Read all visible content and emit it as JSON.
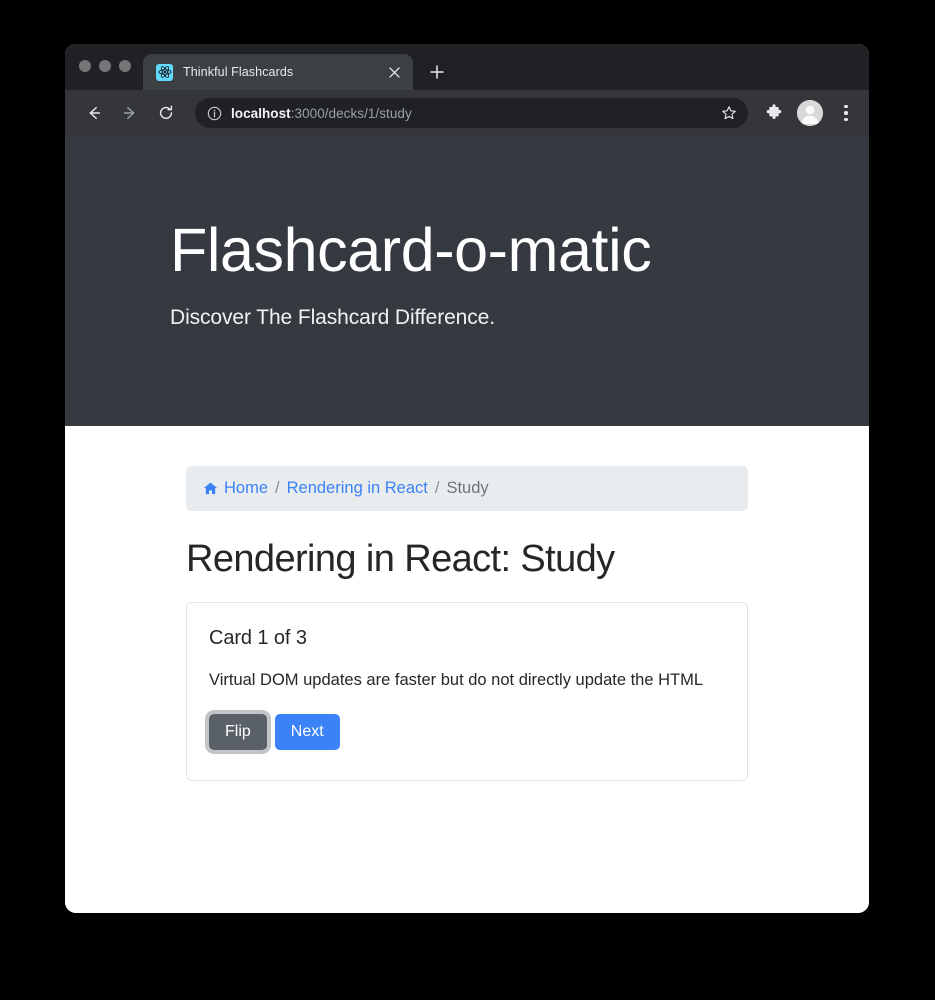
{
  "browser": {
    "traffic_lights": [
      "close",
      "minimize",
      "maximize"
    ],
    "tab": {
      "title": "Thinkful Flashcards",
      "favicon": "react-logo-icon",
      "close_label": "✕"
    },
    "new_tab_label": "+",
    "nav": {
      "back": "←",
      "forward": "→",
      "reload": "⟳"
    },
    "omnibox": {
      "site_info_icon": "info-circle-icon",
      "url_host": "localhost",
      "url_path": ":3000/decks/1/study",
      "star_icon": "star-icon"
    },
    "actions": {
      "extensions_icon": "puzzle-piece-icon",
      "profile_icon": "avatar-icon",
      "menu_icon": "three-dot-menu-icon"
    }
  },
  "page": {
    "jumbotron": {
      "title": "Flashcard-o-matic",
      "subtitle": "Discover The Flashcard Difference."
    },
    "breadcrumb": {
      "home_icon": "home-icon",
      "home_label": "Home",
      "separator": "/",
      "deck_label": "Rendering in React",
      "current_label": "Study"
    },
    "title": "Rendering in React: Study",
    "card": {
      "counter": "Card 1 of 3",
      "content": "Virtual DOM updates are faster but do not directly update the HTML",
      "flip_label": "Flip",
      "next_label": "Next"
    }
  },
  "colors": {
    "jumbotron_bg": "#343a40",
    "primary": "#3b82f6",
    "secondary": "#5a6067",
    "breadcrumb_bg": "#e9ecef",
    "link": "#3b82f6",
    "muted": "#6c757d",
    "favicon_bg": "#61dafb"
  }
}
